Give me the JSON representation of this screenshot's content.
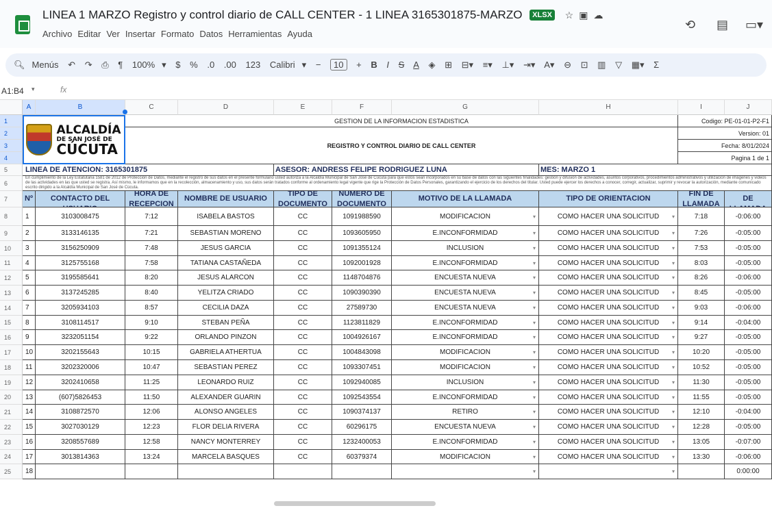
{
  "app": {
    "title": "LINEA 1 MARZO Registro y control diario de CALL CENTER - 1 LINEA 3165301875-MARZO",
    "badge": "XLSX",
    "menu": [
      "Archivo",
      "Editar",
      "Ver",
      "Insertar",
      "Formato",
      "Datos",
      "Herramientas",
      "Ayuda"
    ]
  },
  "toolbar": {
    "search": "Menús",
    "zoom": "100%",
    "currency": "$",
    "percent": "%",
    "dec_dec": ".0",
    "dec_inc": ".00",
    "num_format": "123",
    "font": "Calibri",
    "font_size": "10",
    "minus": "−",
    "plus": "+",
    "bold": "B",
    "italic": "I",
    "strike": "S",
    "textcolor": "A",
    "sigma": "Σ"
  },
  "formula": {
    "namebox": "A1:B4",
    "fx": "fx"
  },
  "columns": [
    "A",
    "B",
    "C",
    "D",
    "E",
    "F",
    "G",
    "H",
    "I",
    "J"
  ],
  "rows": [
    "1",
    "2",
    "3",
    "4",
    "5",
    "6",
    "7",
    "8",
    "9",
    "10",
    "11",
    "12",
    "13",
    "14",
    "15",
    "16",
    "17",
    "18",
    "19",
    "20",
    "21",
    "22",
    "23",
    "24",
    "25"
  ],
  "sheet": {
    "logo": {
      "l1": "ALCALDÍA",
      "l2": "DE SAN JOSÉ DE",
      "l3": "CÚCUTA"
    },
    "gestion": "GESTION DE LA INFORMACION ESTADISTICA",
    "codigo": "Codigo: PE-01-01-P2-F1",
    "version": "Version: 01",
    "fecha": "Fecha: 8/01/2024",
    "pagina": "Pagina 1 de 1",
    "registro": "REGISTRO Y CONTROL DIARIO DE CALL CENTER",
    "linea": "LINEA DE ATENCION: 3165301875",
    "asesor": "ASESOR:  ANDRESS FELIPE RODRIGUEZ LUNA",
    "mes": "MES: MARZO 1",
    "legal": "En cumplimiento de la Ley Estatutaria 1581 de 2012 de Protección de Datos, mediante el registro de sus datos en el presente formulario usted autoriza a la Alcaldía Municipal de San José de Cúcuta para que estos sean incorporados en su base de datos con las siguientes finalidades: gestión y difusión de actividades, asuntos corporativos, procedimientos administrativos y utilización de imágenes y videos de las actividades en las que usted se registra. Así mismo, le informamos que en la recolección, almacenamiento y uso, sus datos serán tratados conforme al ordenamiento legal vigente que rige la Protección de Datos Personales, garantizando el ejercicio de los derechos del titular. Usted puede ejercer los derechos a conocer, corregir, actualizar, suprimir y revocar la autorización, mediante comunicado escrito dirigido a la Alcaldía Municipal de San José de Cúcuta.",
    "headers": [
      "Nº",
      "TELEFONO DE CONTACTO DEL USUARIO",
      "HORA DE RECEPCION",
      "NOMBRE DE USUARIO",
      "TIPO DE DOCUMENTO",
      "NUMERO DE DOCUMENTO",
      "MOTIVO DE LA LLAMADA",
      "TIPO DE ORIENTACION",
      "FIN DE LLAMADA",
      "DURACION DE LLAMADA"
    ],
    "records": [
      [
        "1",
        "3103008475",
        "7:12",
        "ISABELA BASTOS",
        "CC",
        "1091988590",
        "MODIFICACION",
        "COMO HACER UNA SOLICITUD",
        "7:18",
        "-0:06:00"
      ],
      [
        "2",
        "3133146135",
        "7:21",
        "SEBASTIAN MORENO",
        "CC",
        "1093605950",
        "E.INCONFORMIDAD",
        "COMO HACER UNA SOLICITUD",
        "7:26",
        "-0:05:00"
      ],
      [
        "3",
        "3156250909",
        "7:48",
        "JESUS GARCIA",
        "CC",
        "1091355124",
        "INCLUSION",
        "COMO HACER UNA SOLICITUD",
        "7:53",
        "-0:05:00"
      ],
      [
        "4",
        "3125755168",
        "7:58",
        "TATIANA CASTAÑEDA",
        "CC",
        "1092001928",
        "E.INCONFORMIDAD",
        "COMO HACER UNA SOLICITUD",
        "8:03",
        "-0:05:00"
      ],
      [
        "5",
        "3195585641",
        "8:20",
        "JESUS ALARCON",
        "CC",
        "1148704876",
        "ENCUESTA NUEVA",
        "COMO HACER UNA SOLICITUD",
        "8:26",
        "-0:06:00"
      ],
      [
        "6",
        "3137245285",
        "8:40",
        "YELITZA CRIADO",
        "CC",
        "1090390390",
        "ENCUESTA NUEVA",
        "COMO HACER UNA SOLICITUD",
        "8:45",
        "-0:05:00"
      ],
      [
        "7",
        "3205934103",
        "8:57",
        "CECILIA DAZA",
        "CC",
        "27589730",
        "ENCUESTA NUEVA",
        "COMO HACER UNA SOLICITUD",
        "9:03",
        "-0:06:00"
      ],
      [
        "8",
        "3108114517",
        "9:10",
        "STEBAN PEÑA",
        "CC",
        "1123811829",
        "E.INCONFORMIDAD",
        "COMO HACER UNA SOLICITUD",
        "9:14",
        "-0:04:00"
      ],
      [
        "9",
        "3232051154",
        "9:22",
        "ORLANDO PINZON",
        "CC",
        "1004926167",
        "E.INCONFORMIDAD",
        "COMO HACER UNA SOLICITUD",
        "9:27",
        "-0:05:00"
      ],
      [
        "10",
        "3202155643",
        "10:15",
        "GABRIELA ATHERTUA",
        "CC",
        "1004843098",
        "MODIFICACION",
        "COMO HACER UNA SOLICITUD",
        "10:20",
        "-0:05:00"
      ],
      [
        "11",
        "3202320006",
        "10:47",
        "SEBASTIAN PEREZ",
        "CC",
        "1093307451",
        "MODIFICACION",
        "COMO HACER UNA SOLICITUD",
        "10:52",
        "-0:05:00"
      ],
      [
        "12",
        "3202410658",
        "11:25",
        "LEONARDO RUIZ",
        "CC",
        "1092940085",
        "INCLUSION",
        "COMO HACER UNA SOLICITUD",
        "11:30",
        "-0:05:00"
      ],
      [
        "13",
        "(607)5826453",
        "11:50",
        "ALEXANDER GUARIN",
        "CC",
        "1092543554",
        "E.INCONFORMIDAD",
        "COMO HACER UNA SOLICITUD",
        "11:55",
        "-0:05:00"
      ],
      [
        "14",
        "3108872570",
        "12:06",
        "ALONSO ANGELES",
        "CC",
        "1090374137",
        "RETIRO",
        "COMO HACER UNA SOLICITUD",
        "12:10",
        "-0:04:00"
      ],
      [
        "15",
        "3027030129",
        "12:23",
        "FLOR DELIA RIVERA",
        "CC",
        "60296175",
        "ENCUESTA NUEVA",
        "COMO HACER UNA SOLICITUD",
        "12:28",
        "-0:05:00"
      ],
      [
        "16",
        "3208557689",
        "12:58",
        "NANCY MONTERREY",
        "CC",
        "1232400053",
        "E.INCONFORMIDAD",
        "COMO HACER UNA SOLICITUD",
        "13:05",
        "-0:07:00"
      ],
      [
        "17",
        "3013814363",
        "13:24",
        "MARCELA BASQUES",
        "CC",
        "60379374",
        "MODIFICACION",
        "COMO HACER UNA SOLICITUD",
        "13:30",
        "-0:06:00"
      ],
      [
        "18",
        "",
        "",
        "",
        "",
        "",
        "",
        "",
        "",
        "0:00:00"
      ]
    ]
  }
}
